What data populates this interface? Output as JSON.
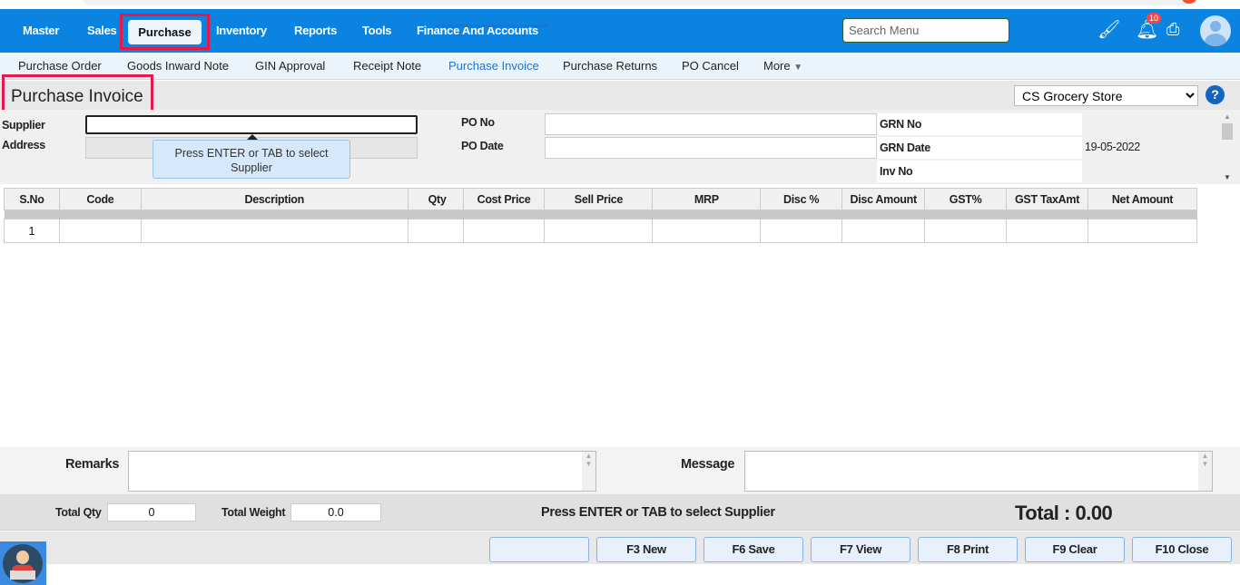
{
  "nav": {
    "items": [
      "Master",
      "Sales",
      "Purchase",
      "Inventory",
      "Reports",
      "Tools",
      "Finance And Accounts"
    ],
    "active": "Purchase",
    "search_placeholder": "Search Menu",
    "notification_count": "10"
  },
  "subnav": {
    "items": [
      "Purchase Order",
      "Goods Inward Note",
      "GIN Approval",
      "Receipt Note",
      "Purchase Invoice",
      "Purchase Returns",
      "PO Cancel",
      "More"
    ],
    "active": "Purchase Invoice"
  },
  "page": {
    "title": "Purchase Invoice",
    "store": "CS Grocery Store",
    "help": "?"
  },
  "form": {
    "supplier_label": "Supplier",
    "address_label": "Address",
    "po_no_label": "PO No",
    "po_date_label": "PO Date",
    "grn_no_label": "GRN No",
    "grn_date_label": "GRN Date",
    "grn_date_value": "19-05-2022",
    "inv_no_label": "Inv No",
    "tooltip": "Press ENTER or TAB to select Supplier"
  },
  "table": {
    "columns": [
      "S.No",
      "Code",
      "Description",
      "Qty",
      "Cost Price",
      "Sell Price",
      "MRP",
      "Disc %",
      "Disc Amount",
      "GST%",
      "GST TaxAmt",
      "Net Amount"
    ],
    "rows": [
      [
        "1",
        "",
        "",
        "",
        "",
        "",
        "",
        "",
        "",
        "",
        "",
        ""
      ]
    ]
  },
  "footer": {
    "remarks_label": "Remarks",
    "message_label": "Message",
    "total_qty_label": "Total Qty",
    "total_qty": "0",
    "total_weight_label": "Total Weight",
    "total_weight": "0.0",
    "status": "Press ENTER or TAB to select Supplier",
    "total": "Total : 0.00"
  },
  "buttons": [
    "",
    "F3 New",
    "F6 Save",
    "F7 View",
    "F8 Print",
    "F9 Clear",
    "F10 Close"
  ]
}
